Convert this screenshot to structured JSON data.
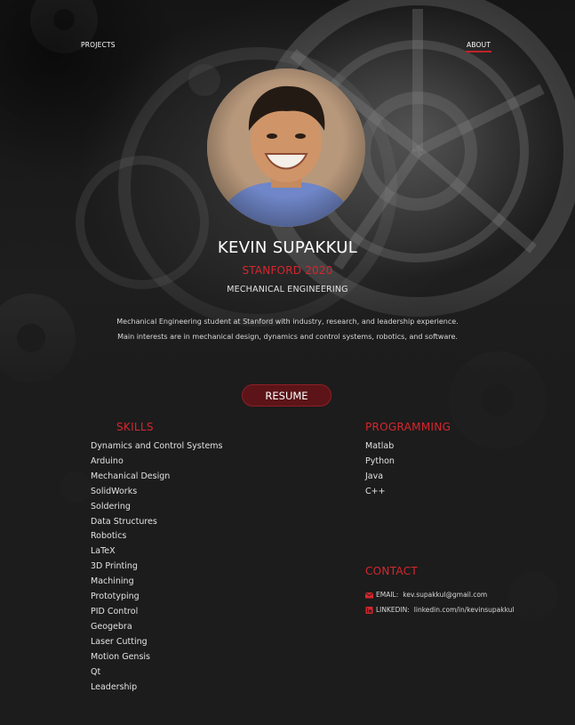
{
  "nav": {
    "projects_label": "PROJECTS",
    "about_label": "ABOUT"
  },
  "profile": {
    "name": "KEVIN SUPAKKUL",
    "school": "STANFORD 2020",
    "major": "MECHANICAL ENGINEERING",
    "bio": "Mechanical Engineering student at Stanford with industry, research, and leadership experience. Main interests are in mechanical design, dynamics and control systems, robotics, and software.",
    "resume_label": "RESUME"
  },
  "skills": {
    "title": "SKILLS",
    "items": [
      "Dynamics and Control Systems",
      "Arduino",
      "Mechanical Design",
      "SolidWorks",
      "Soldering",
      "Data Structures",
      "Robotics",
      "LaTeX",
      "3D Printing",
      "Machining",
      "Prototyping",
      "PID Control",
      "Geogebra",
      "Laser Cutting",
      "Motion Gensis",
      "Qt",
      "Leadership"
    ]
  },
  "programming": {
    "title": "PROGRAMMING",
    "items": [
      "Matlab",
      "Python",
      "Java",
      "C++"
    ]
  },
  "contact": {
    "title": "CONTACT",
    "email_label": "EMAIL:",
    "email_value": "kev.supakkul@gmail.com",
    "linkedin_label": "LINKEDIN:",
    "linkedin_value": "linkedin.com/in/kevinsupakkul"
  },
  "icons": {
    "email": "envelope-icon",
    "linkedin": "linkedin-icon"
  },
  "colors": {
    "accent": "#d7262e",
    "button_bg": "#5c1418",
    "background": "#1b1b1b"
  }
}
